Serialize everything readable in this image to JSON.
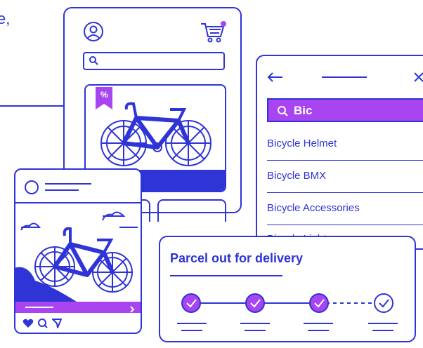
{
  "intro_fragment": {
    "line1": "e,",
    "line2": ","
  },
  "colors": {
    "primary": "#2f34d6",
    "accent": "#a844f0",
    "background": "#ffffff"
  },
  "shop_phone": {
    "icons": [
      "user-icon",
      "cart-icon",
      "search-icon",
      "discount-tag-icon",
      "bicycle-icon"
    ],
    "discount_symbol": "%"
  },
  "search_panel": {
    "query": "Bic",
    "results": [
      "Bicycle Helmet",
      "Bicycle BMX",
      "Bicycle Accessories",
      "Bicycle Light"
    ],
    "icons": [
      "back-arrow-icon",
      "close-icon",
      "search-icon"
    ]
  },
  "social_post": {
    "icons": [
      "heart-icon",
      "comment-icon",
      "share-icon",
      "chevron-right-icon",
      "bicycle-icon"
    ]
  },
  "delivery": {
    "title": "Parcel out for delivery",
    "steps_completed": 3,
    "steps_total": 4
  }
}
